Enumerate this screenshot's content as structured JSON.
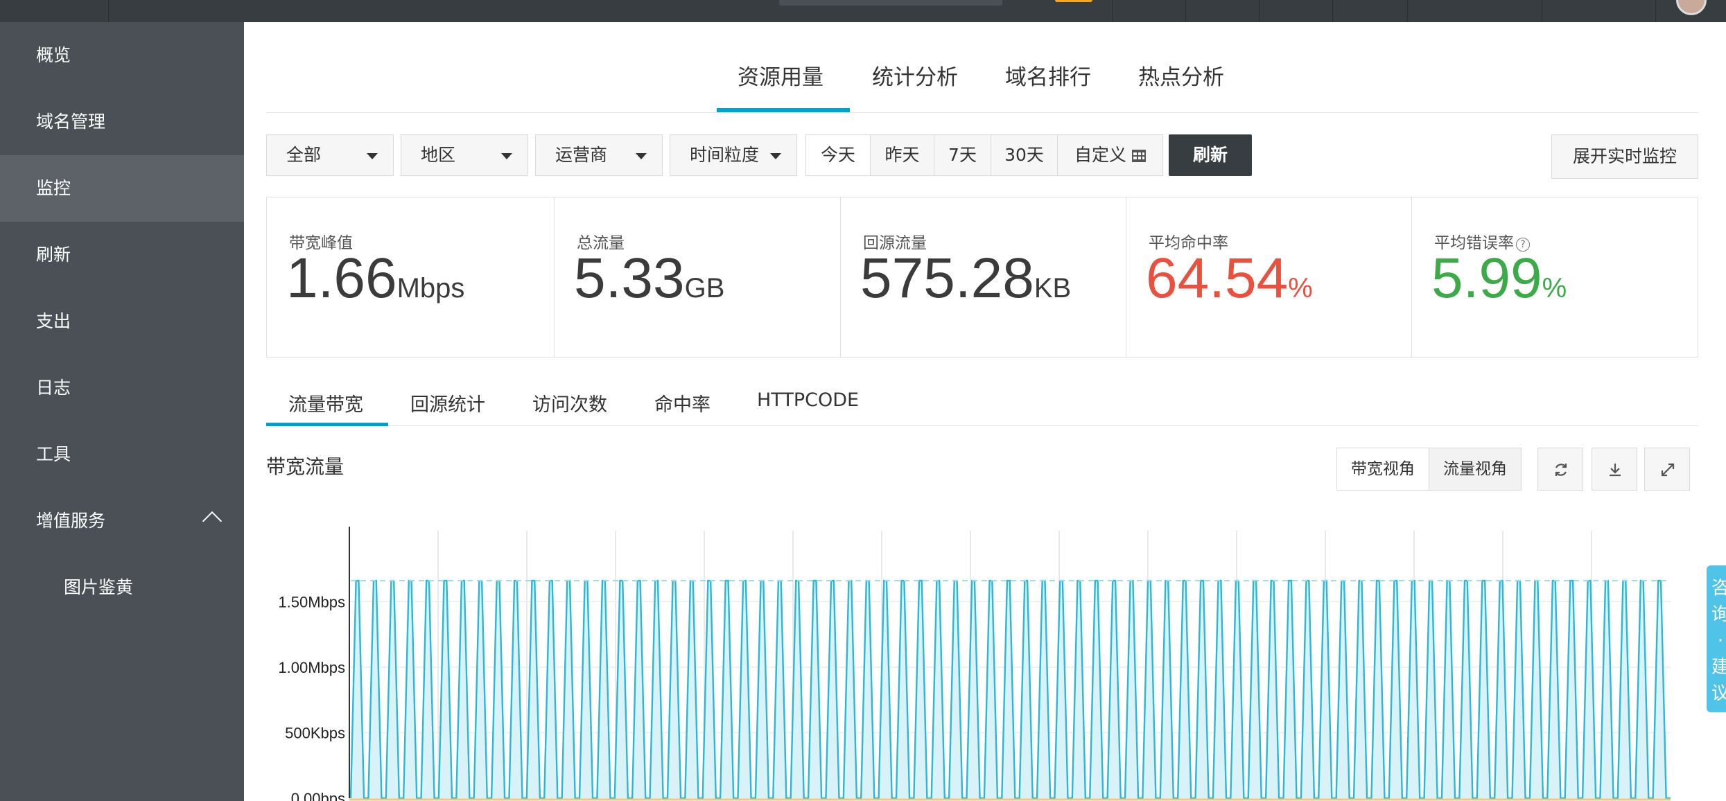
{
  "sidebar": {
    "items": [
      {
        "label": "概览"
      },
      {
        "label": "域名管理"
      },
      {
        "label": "监控"
      },
      {
        "label": "刷新"
      },
      {
        "label": "支出"
      },
      {
        "label": "日志"
      },
      {
        "label": "工具"
      },
      {
        "label": "增值服务"
      },
      {
        "label": "图片鉴黄"
      }
    ],
    "active": "监控"
  },
  "top_tabs": [
    {
      "label": "资源用量"
    },
    {
      "label": "统计分析"
    },
    {
      "label": "域名排行"
    },
    {
      "label": "热点分析"
    }
  ],
  "filters": {
    "scope": "全部",
    "region": "地区",
    "isp": "运营商",
    "granularity": "时间粒度",
    "ranges": [
      "今天",
      "昨天",
      "7天",
      "30天",
      "自定义"
    ],
    "refresh_label": "刷新",
    "monitor_label": "展开实时监控"
  },
  "stats": [
    {
      "label": "带宽峰值",
      "value": "1.66",
      "unit": "Mbps",
      "color": "#3b3b3b"
    },
    {
      "label": "总流量",
      "value": "5.33",
      "unit": "GB",
      "color": "#3b3b3b"
    },
    {
      "label": "回源流量",
      "value": "575.28",
      "unit": "KB",
      "color": "#3b3b3b"
    },
    {
      "label": "平均命中率",
      "value": "64.54",
      "unit": "%",
      "color": "#e9503d"
    },
    {
      "label": "平均错误率",
      "value": "5.99",
      "unit": "%",
      "color": "#3daa4a"
    }
  ],
  "sub_tabs": [
    {
      "label": "流量带宽"
    },
    {
      "label": "回源统计"
    },
    {
      "label": "访问次数"
    },
    {
      "label": "命中率"
    },
    {
      "label": "HTTPCODE"
    }
  ],
  "chart_header": {
    "title": "带宽流量",
    "bandwidth_view": "带宽视角",
    "traffic_view": "流量视角"
  },
  "feedback": {
    "label": "咨询·建议"
  },
  "chart_data": {
    "type": "area",
    "title": "带宽流量",
    "y_ticks": [
      "0.00bps",
      "500Kbps",
      "1.00Mbps",
      "1.50Mbps"
    ],
    "ylim_mbps": [
      0,
      2
    ],
    "series": [
      {
        "values_mbps": [
          0,
          1.66
        ],
        "pattern": "oscillating",
        "cycles": 75,
        "color": "#2bb7d6"
      }
    ],
    "peak_mbps": 1.66,
    "grid": true
  }
}
